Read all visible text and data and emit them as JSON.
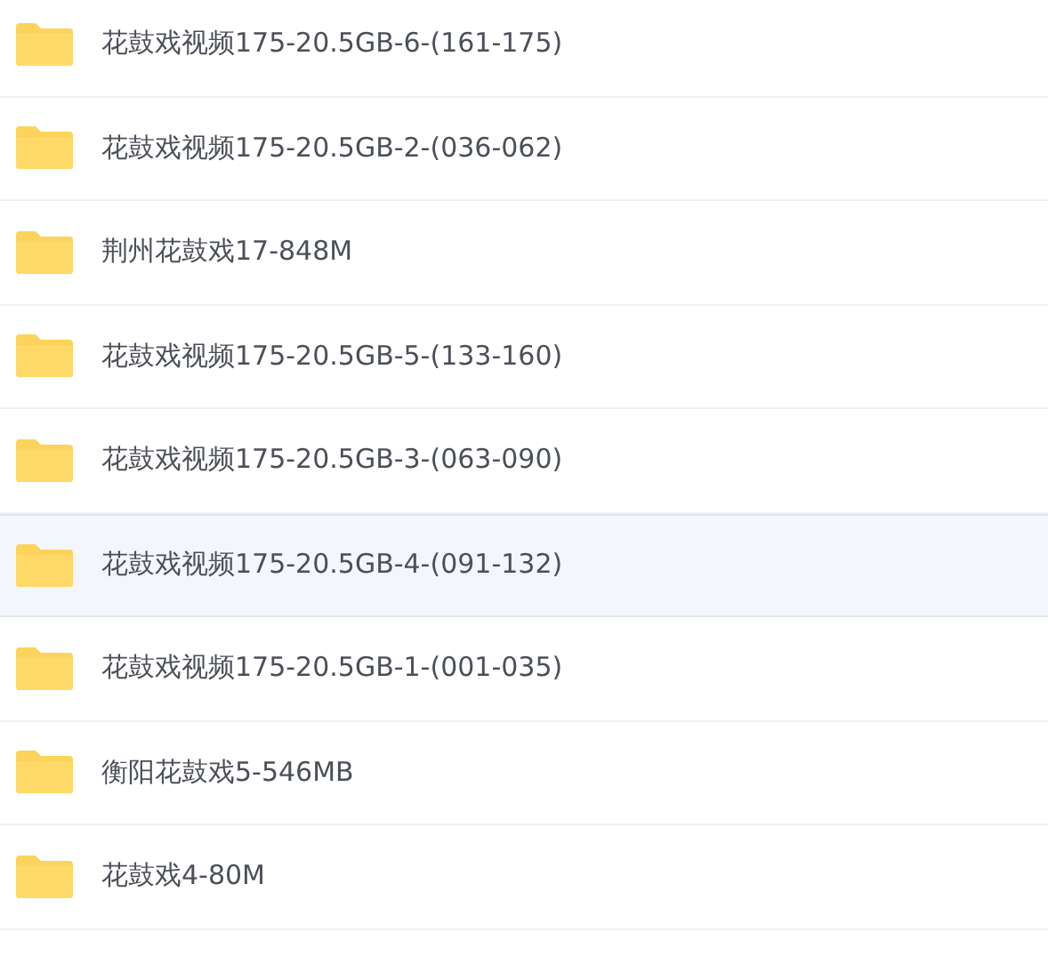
{
  "folders": [
    {
      "name": "花鼓戏视频175-20.5GB-6-(161-175)",
      "selected": false
    },
    {
      "name": "花鼓戏视频175-20.5GB-2-(036-062)",
      "selected": false
    },
    {
      "name": "荆州花鼓戏17-848M",
      "selected": false
    },
    {
      "name": "花鼓戏视频175-20.5GB-5-(133-160)",
      "selected": false
    },
    {
      "name": "花鼓戏视频175-20.5GB-3-(063-090)",
      "selected": false
    },
    {
      "name": "花鼓戏视频175-20.5GB-4-(091-132)",
      "selected": true
    },
    {
      "name": "花鼓戏视频175-20.5GB-1-(001-035)",
      "selected": false
    },
    {
      "name": "衡阳花鼓戏5-546MB",
      "selected": false
    },
    {
      "name": "花鼓戏4-80M",
      "selected": false
    }
  ]
}
